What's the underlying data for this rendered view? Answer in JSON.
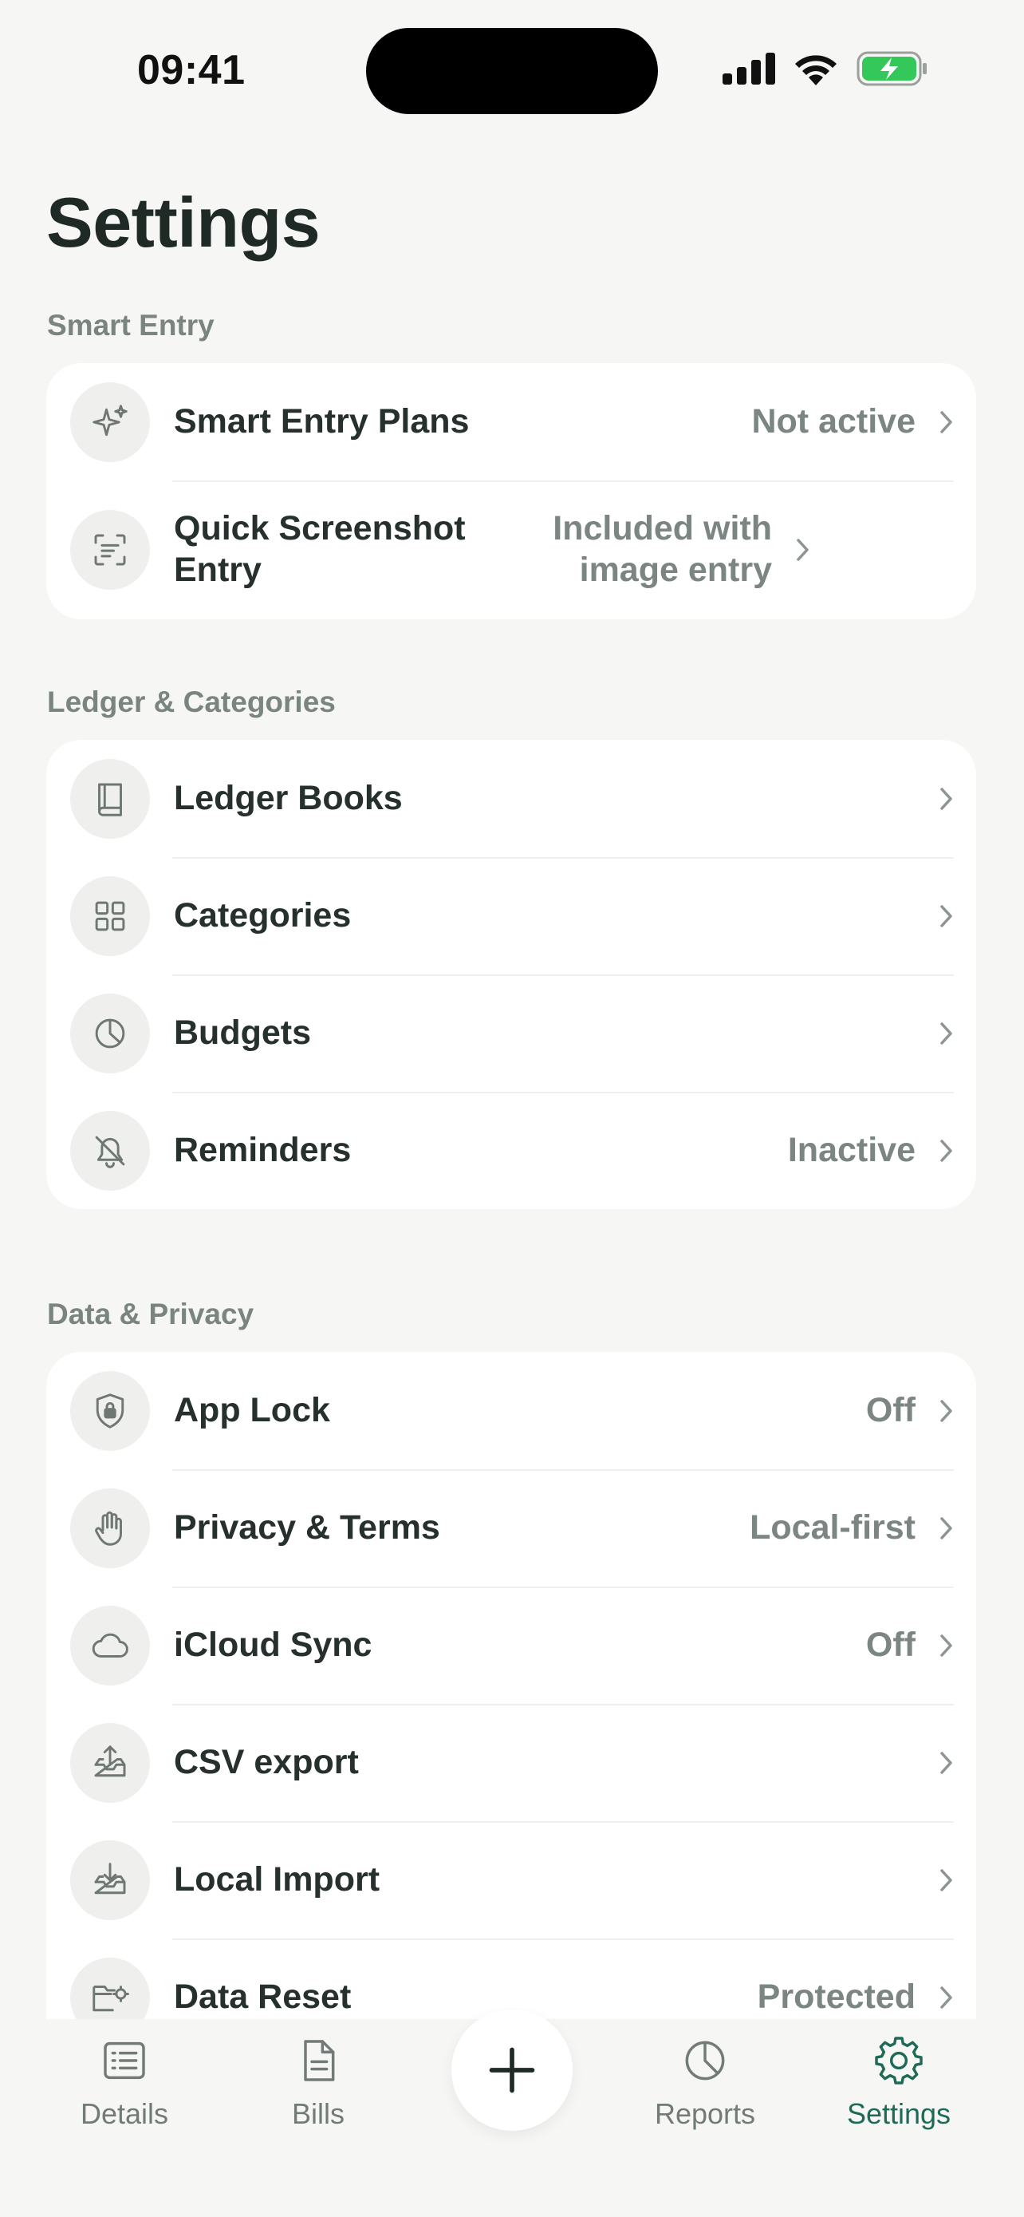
{
  "status_bar": {
    "time": "09:41"
  },
  "page_title": "Settings",
  "sections": [
    {
      "label": "Smart Entry",
      "rows": [
        {
          "icon": "sparkles-icon",
          "label": "Smart Entry Plans",
          "value": "Not active"
        },
        {
          "icon": "screenshot-scan-icon",
          "label": "Quick Screenshot Entry",
          "value": "Included with image entry"
        }
      ]
    },
    {
      "label": "Ledger & Categories",
      "rows": [
        {
          "icon": "book-icon",
          "label": "Ledger Books",
          "value": ""
        },
        {
          "icon": "grid-icon",
          "label": "Categories",
          "value": ""
        },
        {
          "icon": "pie-clock-icon",
          "label": "Budgets",
          "value": ""
        },
        {
          "icon": "bell-off-icon",
          "label": "Reminders",
          "value": "Inactive"
        }
      ]
    },
    {
      "label": "Data & Privacy",
      "rows": [
        {
          "icon": "shield-lock-icon",
          "label": "App Lock",
          "value": "Off"
        },
        {
          "icon": "hand-icon",
          "label": "Privacy & Terms",
          "value": "Local-first"
        },
        {
          "icon": "cloud-icon",
          "label": "iCloud Sync",
          "value": "Off"
        },
        {
          "icon": "tray-upload-icon",
          "label": "CSV export",
          "value": ""
        },
        {
          "icon": "tray-download-icon",
          "label": "Local Import",
          "value": ""
        },
        {
          "icon": "folder-gear-icon",
          "label": "Data Reset",
          "value": "Protected"
        }
      ]
    }
  ],
  "tab_bar": {
    "tabs": [
      {
        "icon": "list-icon",
        "label": "Details"
      },
      {
        "icon": "document-icon",
        "label": "Bills"
      },
      {
        "icon": "pie-chart-icon",
        "label": "Reports"
      },
      {
        "icon": "gear-icon",
        "label": "Settings"
      }
    ],
    "active": "Settings"
  },
  "colors": {
    "accent": "#1e6a57",
    "background": "#f6f6f4",
    "card": "#ffffff",
    "muted_text": "#7b8581",
    "battery": "#34c759"
  }
}
